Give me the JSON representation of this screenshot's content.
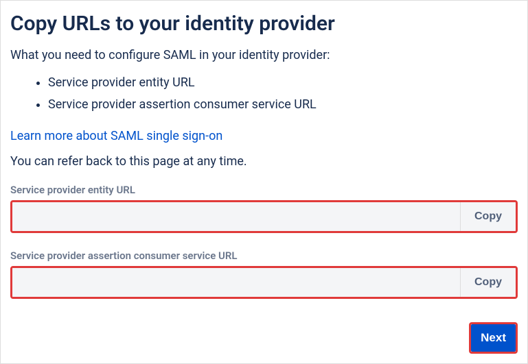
{
  "heading": "Copy URLs to your identity provider",
  "intro": "What you need to configure SAML in your identity provider:",
  "bullets": [
    "Service provider entity URL",
    "Service provider assertion consumer service URL"
  ],
  "learn_more": "Learn more about SAML single sign-on",
  "refer": "You can refer back to this page at any time.",
  "fields": {
    "entity": {
      "label": "Service provider entity URL",
      "value": "",
      "copy": "Copy"
    },
    "acs": {
      "label": "Service provider assertion consumer service URL",
      "value": "",
      "copy": "Copy"
    }
  },
  "next": "Next"
}
